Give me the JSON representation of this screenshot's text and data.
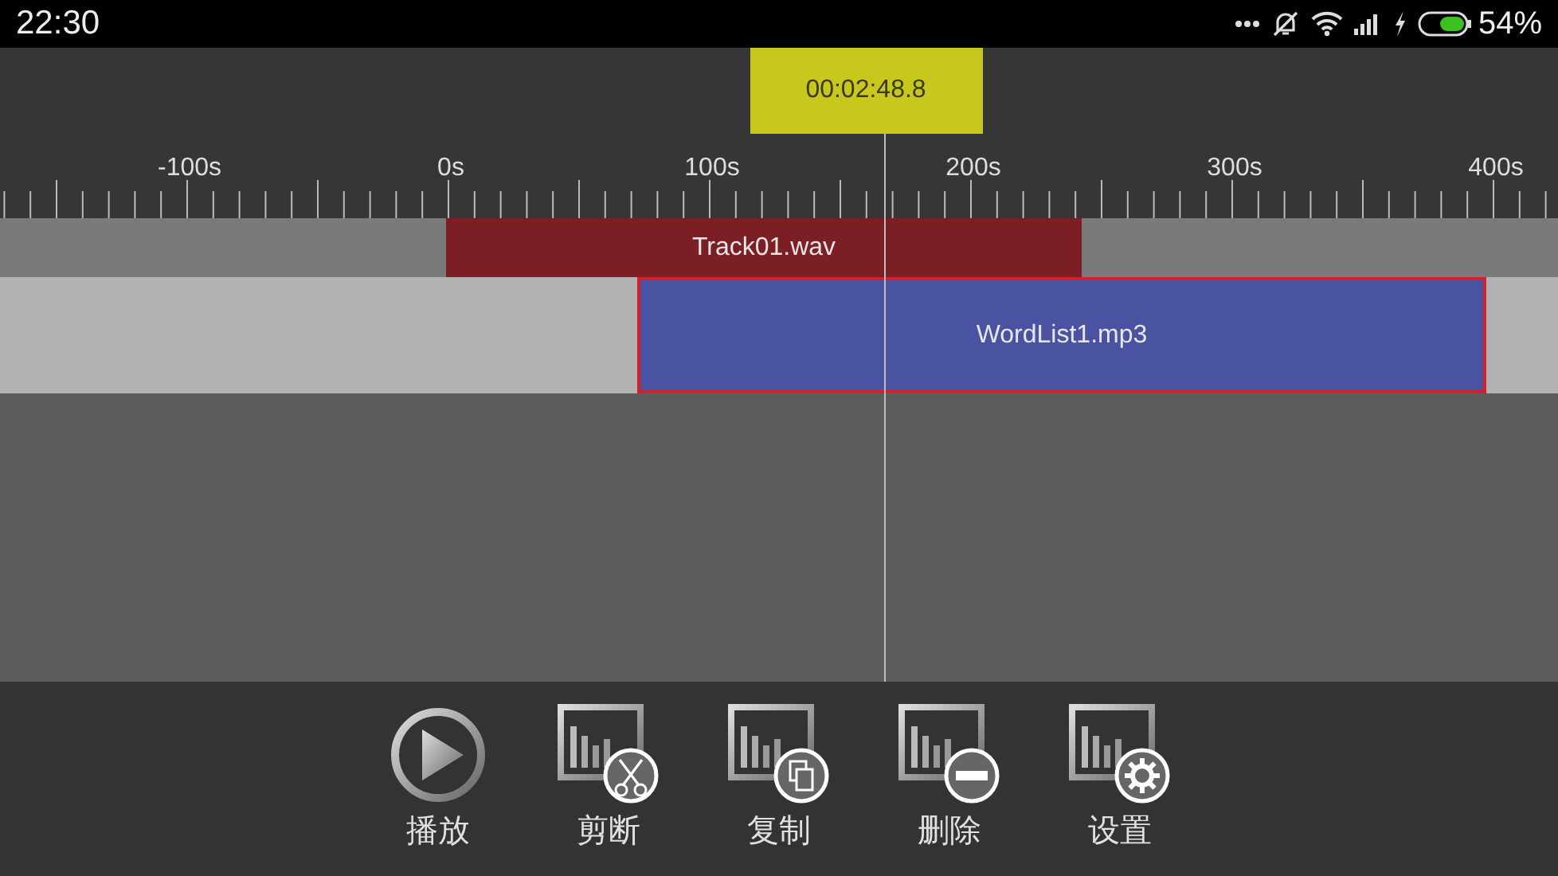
{
  "status_bar": {
    "time": "22:30",
    "battery": "54%"
  },
  "timecode": "00:02:48.8",
  "ruler": {
    "labels": [
      "-100s",
      "0s",
      "100s",
      "200s",
      "300s",
      "400s"
    ]
  },
  "tracks": [
    {
      "clip": {
        "name": "Track01.wav",
        "selected": false
      }
    },
    {
      "clip": {
        "name": "WordList1.mp3",
        "selected": true
      }
    }
  ],
  "toolbar": [
    {
      "kind": "play",
      "label": "播放"
    },
    {
      "kind": "cut",
      "label": "剪断"
    },
    {
      "kind": "copy",
      "label": "复制"
    },
    {
      "kind": "delete",
      "label": "删除"
    },
    {
      "kind": "settings",
      "label": "设置"
    }
  ]
}
